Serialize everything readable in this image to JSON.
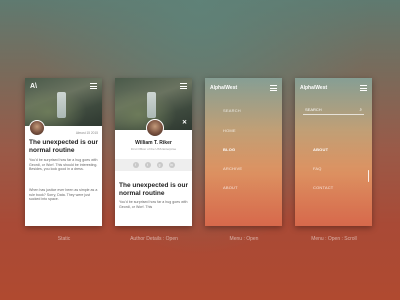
{
  "screens": [
    {
      "brand_mark": "A\\",
      "date": "Almost 15 2015",
      "title": "The unexpected is our normal routine",
      "paragraphs": [
        "You'd be surprised how far a hug goes with Geordi, or Worf. This should be interesting. Besides, you look good in a dress.",
        "When has justice ever been as simple as a rule book? Sorry, Data. They were just sucked into space."
      ],
      "caption": "Static"
    },
    {
      "author_name": "William T. Riker",
      "author_role": "First Officer of the USS Enterprise",
      "social_icons": [
        "f",
        "t",
        "g",
        "in"
      ],
      "title": "The unexpected is our normal routine",
      "paragraph": "You'd be surprised how far a hug goes with Geordi, or Worf. This",
      "caption": "Author Details : Open"
    },
    {
      "brand": "Alpha\\West",
      "nav": [
        "SEARCH",
        "HOME",
        "BLOG",
        "ARCHIVE",
        "ABOUT"
      ],
      "active": "BLOG",
      "caption": "Menu : Open"
    },
    {
      "brand": "Alpha\\West",
      "search_placeholder": "SEARCH",
      "nav": [
        "ABOUT",
        "FAQ",
        "CONTACT"
      ],
      "active": "ABOUT",
      "caption": "Menu : Open : Scroll"
    }
  ]
}
